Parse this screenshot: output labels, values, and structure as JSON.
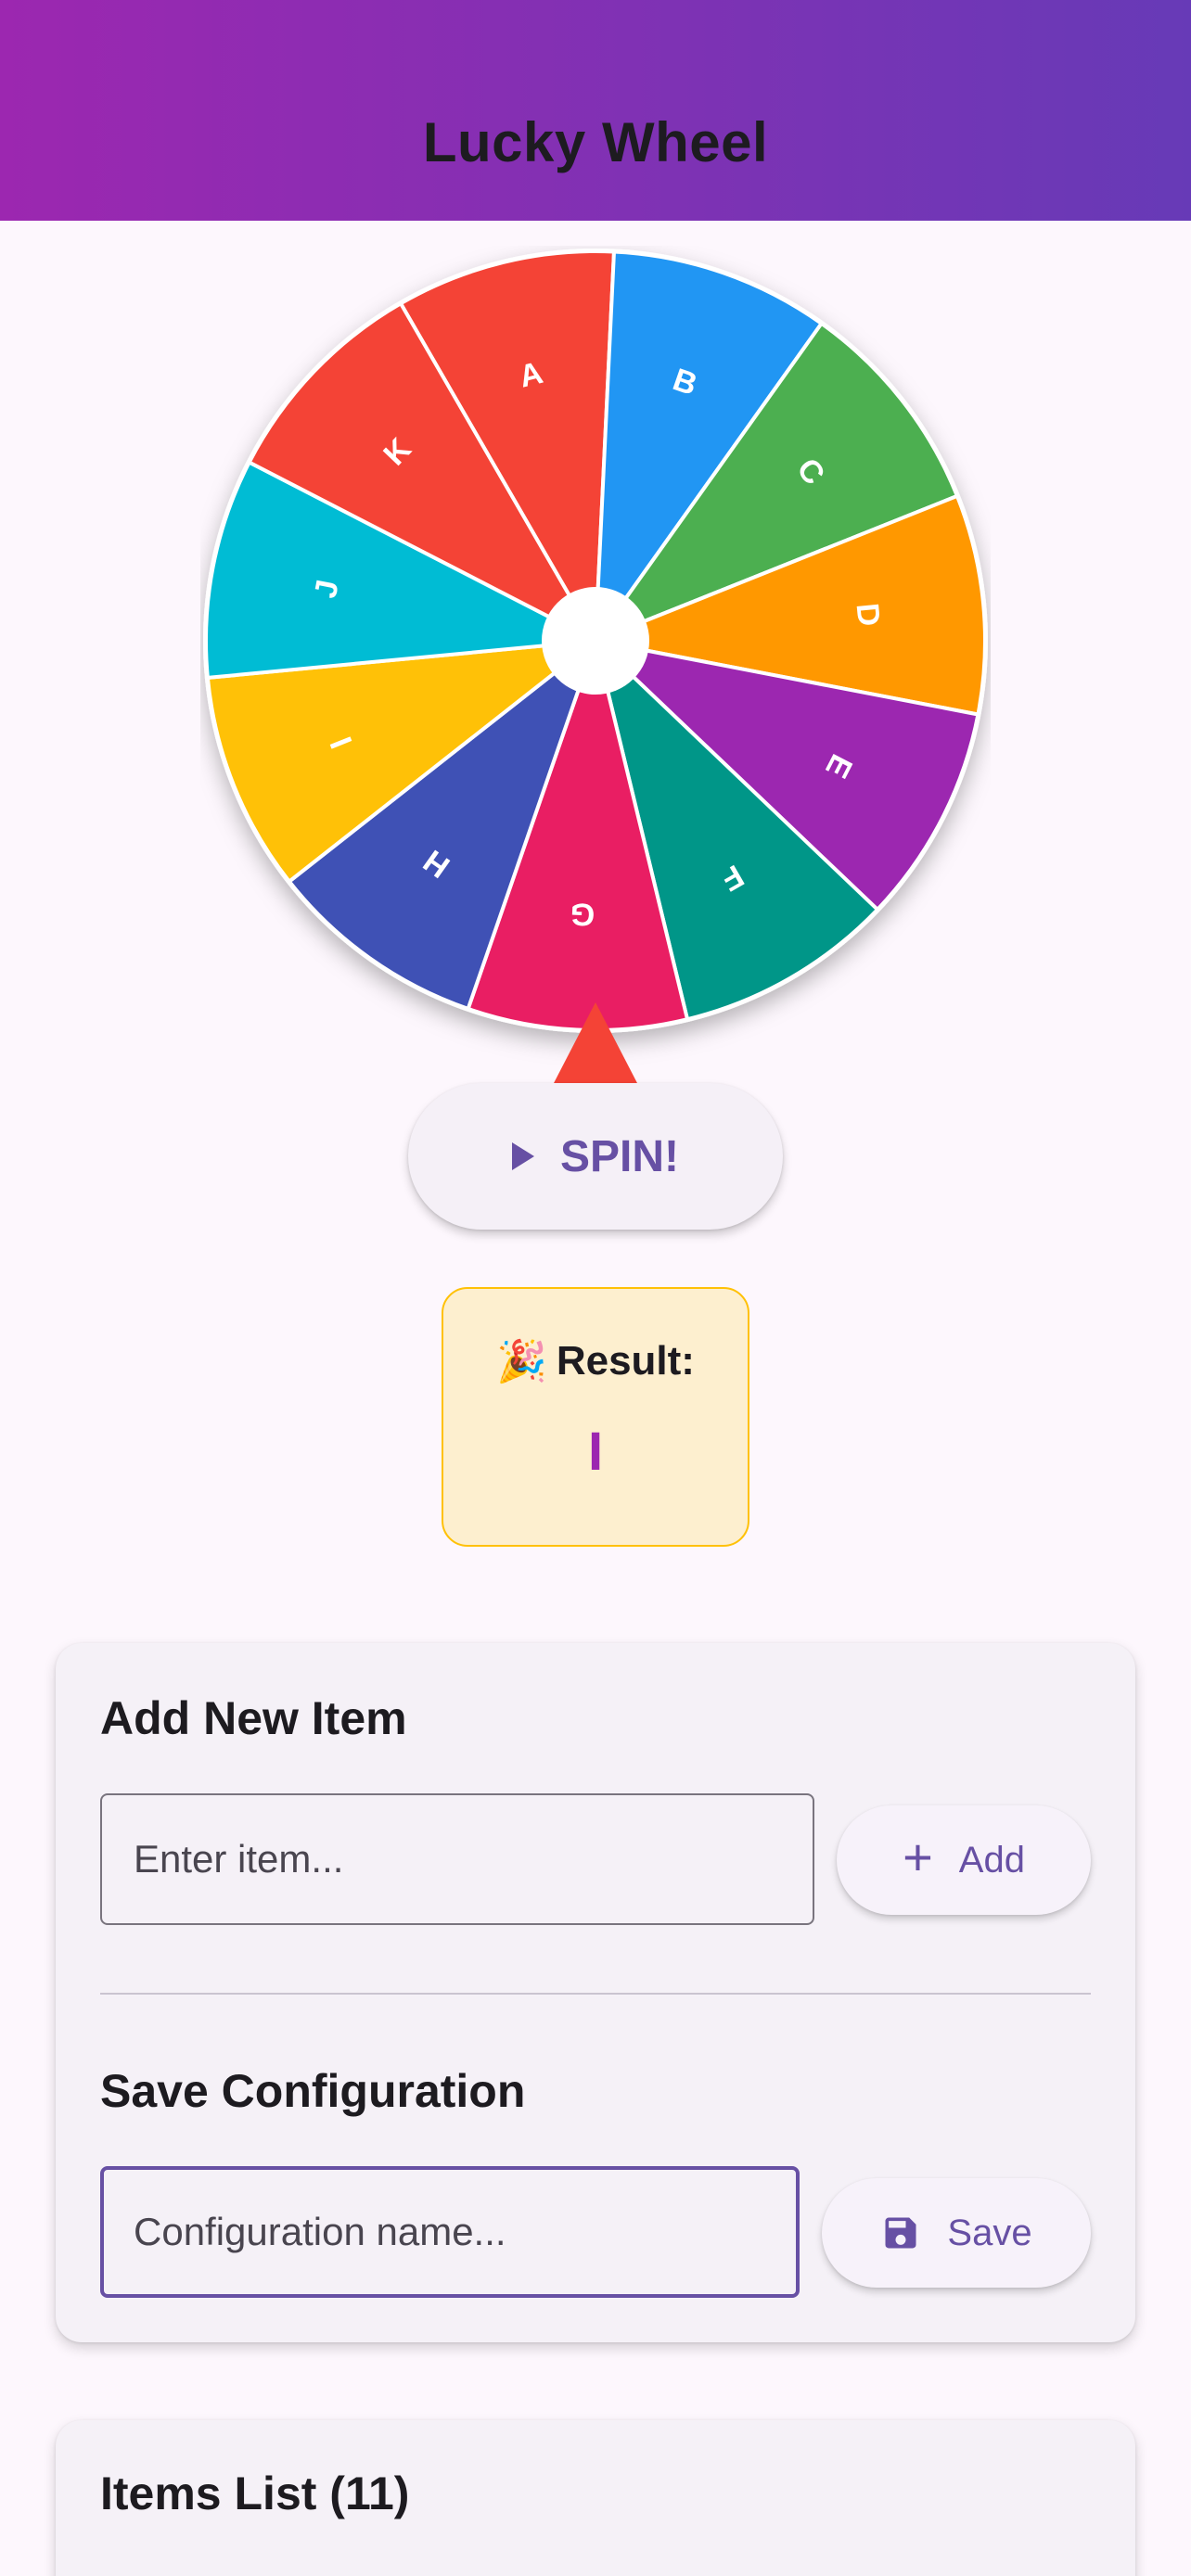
{
  "app": {
    "title": "Lucky Wheel"
  },
  "wheel": {
    "segments": [
      {
        "label": "A",
        "color": "#f44336"
      },
      {
        "label": "B",
        "color": "#2196f3"
      },
      {
        "label": "C",
        "color": "#4caf50"
      },
      {
        "label": "D",
        "color": "#ff9800"
      },
      {
        "label": "E",
        "color": "#9c27b0"
      },
      {
        "label": "F",
        "color": "#009688"
      },
      {
        "label": "G",
        "color": "#e91e63"
      },
      {
        "label": "H",
        "color": "#3f51b5"
      },
      {
        "label": "I",
        "color": "#ffc107"
      },
      {
        "label": "J",
        "color": "#00bcd4"
      },
      {
        "label": "K",
        "color": "#f44336"
      }
    ],
    "pointer_color": "#f44336"
  },
  "spin": {
    "label": "SPIN!",
    "icon": "play-icon"
  },
  "result": {
    "label": "Result:",
    "icon": "party-popper-icon",
    "emoji": "🎉",
    "value": "I"
  },
  "add_item": {
    "title": "Add New Item",
    "placeholder": "Enter item...",
    "button_label": "Add",
    "icon": "plus-icon"
  },
  "save_config": {
    "title": "Save Configuration",
    "placeholder": "Configuration name...",
    "button_label": "Save",
    "icon": "save-icon"
  },
  "items_list": {
    "title": "Items List (11)"
  },
  "colors": {
    "accent": "#6750a4",
    "appbar_start": "#9c27b0",
    "appbar_end": "#673ab7",
    "result_bg": "#fdefcf",
    "result_border": "#ffc107"
  }
}
